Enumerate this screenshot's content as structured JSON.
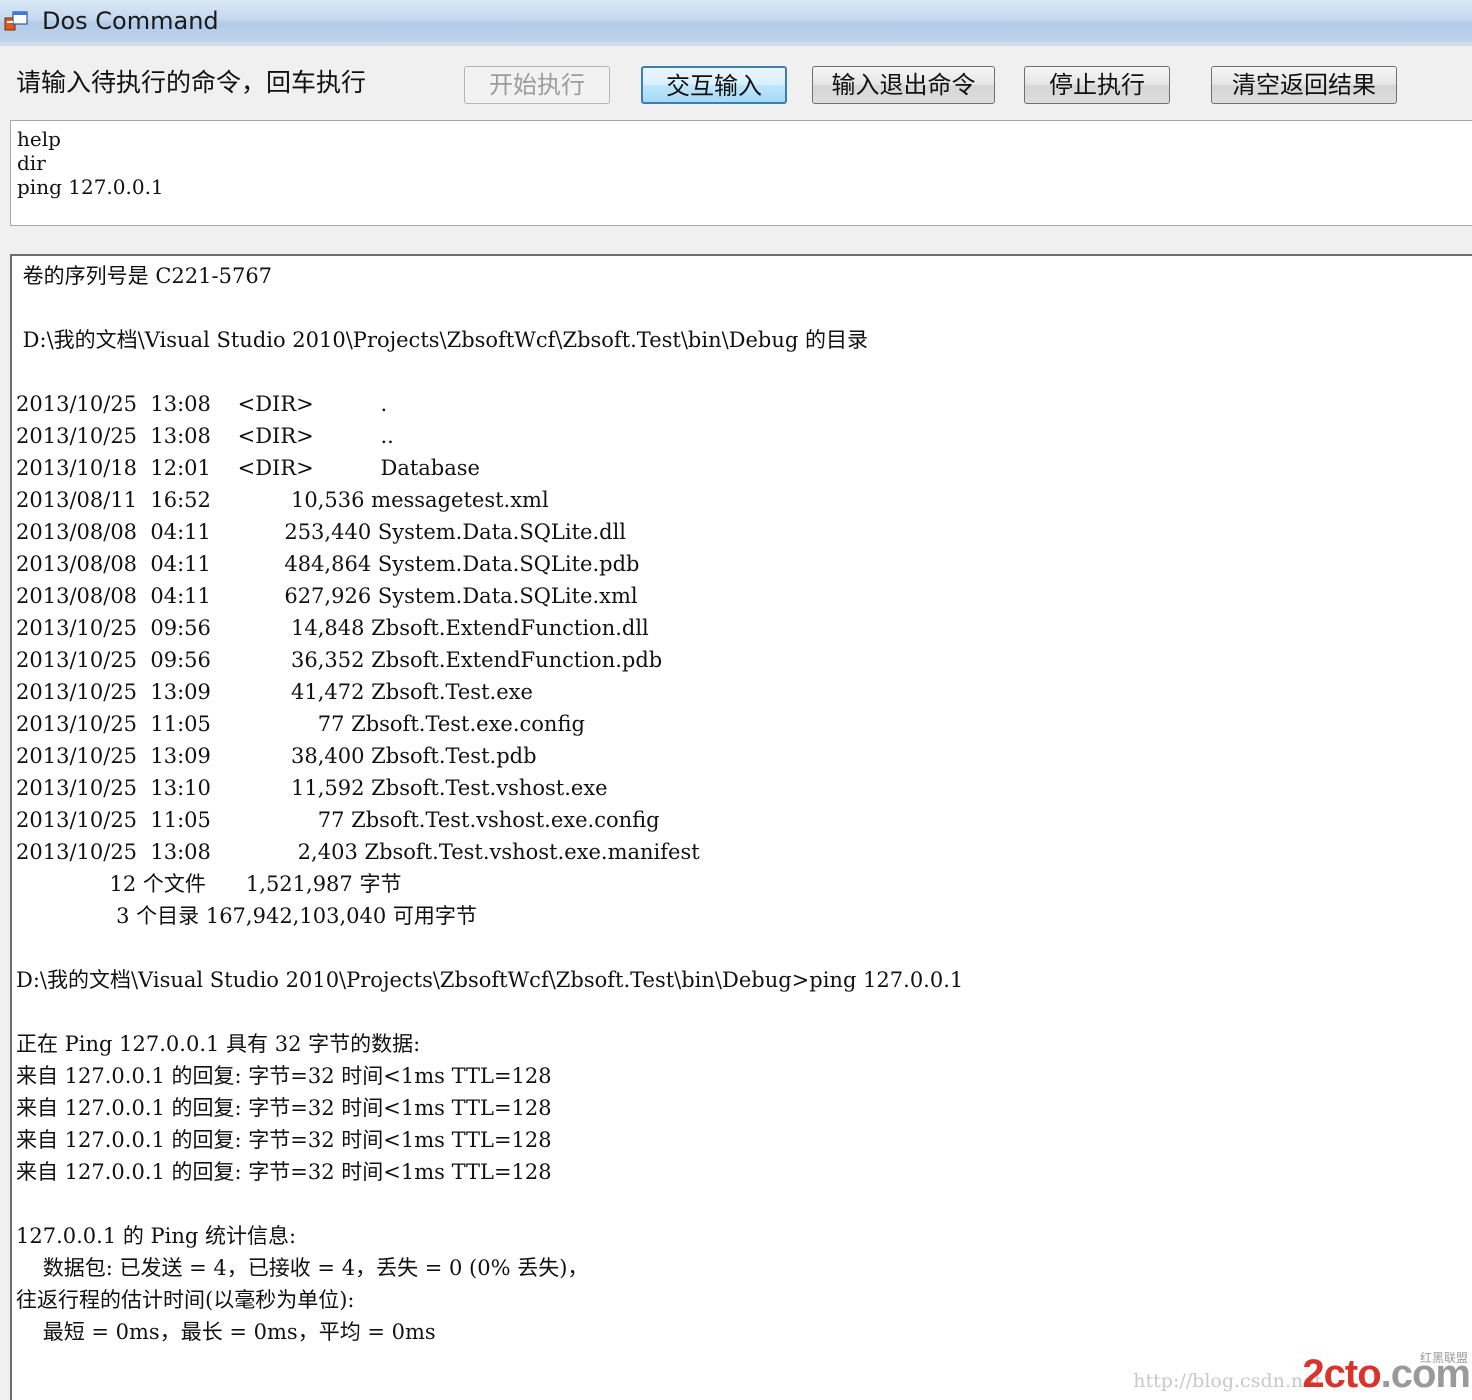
{
  "window": {
    "title": "Dos Command"
  },
  "toolbar": {
    "prompt": "请输入待执行的命令，回车执行",
    "buttons": {
      "start": "开始执行",
      "interactive": "交互输入",
      "exit_cmd": "输入退出命令",
      "stop": "停止执行",
      "clear": "清空返回结果"
    }
  },
  "command_input": {
    "value": "help\ndir\nping 127.0.0.1"
  },
  "output": {
    "lines": [
      " 卷的序列号是 C221-5767",
      "",
      " D:\\我的文档\\Visual Studio 2010\\Projects\\ZbsoftWcf\\Zbsoft.Test\\bin\\Debug 的目录",
      "",
      "2013/10/25  13:08    <DIR>          .",
      "2013/10/25  13:08    <DIR>          ..",
      "2013/10/18  12:01    <DIR>          Database",
      "2013/08/11  16:52            10,536 messagetest.xml",
      "2013/08/08  04:11           253,440 System.Data.SQLite.dll",
      "2013/08/08  04:11           484,864 System.Data.SQLite.pdb",
      "2013/08/08  04:11           627,926 System.Data.SQLite.xml",
      "2013/10/25  09:56            14,848 Zbsoft.ExtendFunction.dll",
      "2013/10/25  09:56            36,352 Zbsoft.ExtendFunction.pdb",
      "2013/10/25  13:09            41,472 Zbsoft.Test.exe",
      "2013/10/25  11:05                77 Zbsoft.Test.exe.config",
      "2013/10/25  13:09            38,400 Zbsoft.Test.pdb",
      "2013/10/25  13:10            11,592 Zbsoft.Test.vshost.exe",
      "2013/10/25  11:05                77 Zbsoft.Test.vshost.exe.config",
      "2013/10/25  13:08             2,403 Zbsoft.Test.vshost.exe.manifest",
      "              12 个文件      1,521,987 字节",
      "               3 个目录 167,942,103,040 可用字节",
      "",
      "D:\\我的文档\\Visual Studio 2010\\Projects\\ZbsoftWcf\\Zbsoft.Test\\bin\\Debug>ping 127.0.0.1",
      "",
      "正在 Ping 127.0.0.1 具有 32 字节的数据:",
      "来自 127.0.0.1 的回复: 字节=32 时间<1ms TTL=128",
      "来自 127.0.0.1 的回复: 字节=32 时间<1ms TTL=128",
      "来自 127.0.0.1 的回复: 字节=32 时间<1ms TTL=128",
      "来自 127.0.0.1 的回复: 字节=32 时间<1ms TTL=128",
      "",
      "127.0.0.1 的 Ping 统计信息:",
      "    数据包: 已发送 = 4，已接收 = 4，丢失 = 0 (0% 丢失)，",
      "往返行程的估计时间(以毫秒为单位):",
      "    最短 = 0ms，最长 = 0ms，平均 = 0ms"
    ]
  },
  "watermark": {
    "url": "http://blog.csdn.net",
    "logo_main": "2cto",
    "logo_suffix": ".com",
    "logo_sub": "红黑联盟"
  }
}
